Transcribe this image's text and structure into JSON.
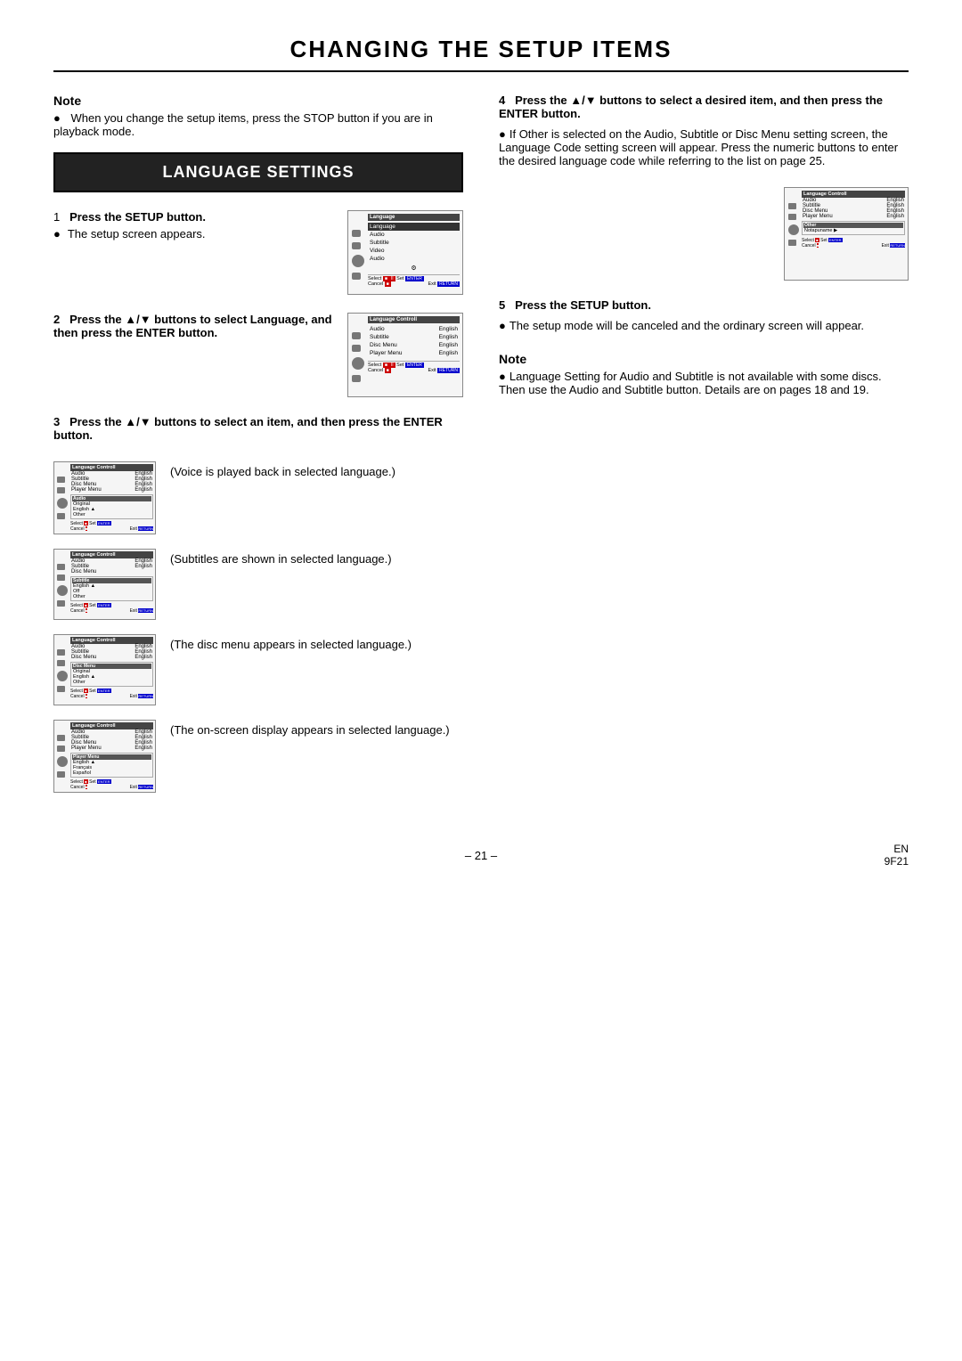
{
  "page": {
    "title": "CHANGING THE SETUP ITEMS",
    "page_number": "– 21 –",
    "page_code": "EN\n9F21"
  },
  "left_col": {
    "note_heading": "Note",
    "note_bullet": "When you change the setup items, press the STOP button if you are in playback mode.",
    "lang_settings_label": "LANGUAGE SETTINGS",
    "step1_num": "1",
    "step1_text": "Press the SETUP button.",
    "step1_bullet": "The setup screen appears.",
    "step2_num": "2",
    "step2_text": "Press the ▲/▼ buttons to select Language, and then press the ENTER button.",
    "step3_num": "3",
    "step3_text": "Press the ▲/▼ buttons to select an item, and then press the ENTER button.",
    "substep1_text": "(Voice is played back in selected language.)",
    "substep2_text": "(Subtitles are shown in selected language.)",
    "substep3_text": "(The disc menu appears in selected language.)",
    "substep4_text": "(The on-screen display appears in selected language.)"
  },
  "right_col": {
    "step4_num": "4",
    "step4_text": "Press the ▲/▼ buttons to select a desired item, and then press the ENTER button.",
    "step4_bullet": "If Other is selected on the Audio, Subtitle or Disc Menu setting screen, the Language Code setting screen will appear. Press the numeric buttons to enter the desired language code while referring to the list on page 25.",
    "step4_ref": "the list on page 25.",
    "step5_num": "5",
    "step5_text": "Press the SETUP button.",
    "step5_bullet": "The setup mode will be canceled and the ordinary screen will appear.",
    "note_heading": "Note",
    "note_bullet": "Language Setting for Audio and Subtitle is not available with some discs. Then use the Audio and Subtitle button. Details are on pages 18 and 19."
  },
  "screens": {
    "step1_screen": {
      "header": "Language Controll",
      "rows": [
        {
          "label": "Audio",
          "value": ""
        },
        {
          "label": "Subtitle",
          "value": ""
        },
        {
          "label": "Disc Menu",
          "value": ""
        },
        {
          "label": "Player Menu",
          "value": ""
        }
      ],
      "footer_select": "Select",
      "footer_set": "Set",
      "footer_cancel": "Cancel",
      "footer_exit": "Exit"
    },
    "step4_screen": {
      "header": "Language Controll",
      "rows": [
        {
          "label": "Audio",
          "value": "English"
        },
        {
          "label": "Subtitle",
          "value": "English"
        },
        {
          "label": "Disc Menu",
          "value": "English"
        },
        {
          "label": "Player Menu",
          "value": "English"
        }
      ],
      "section": "Other",
      "section_item": "Notapuname",
      "footer_select": "Select",
      "footer_set": "Set",
      "footer_cancel": "Cancel",
      "footer_exit": "Exit"
    }
  }
}
